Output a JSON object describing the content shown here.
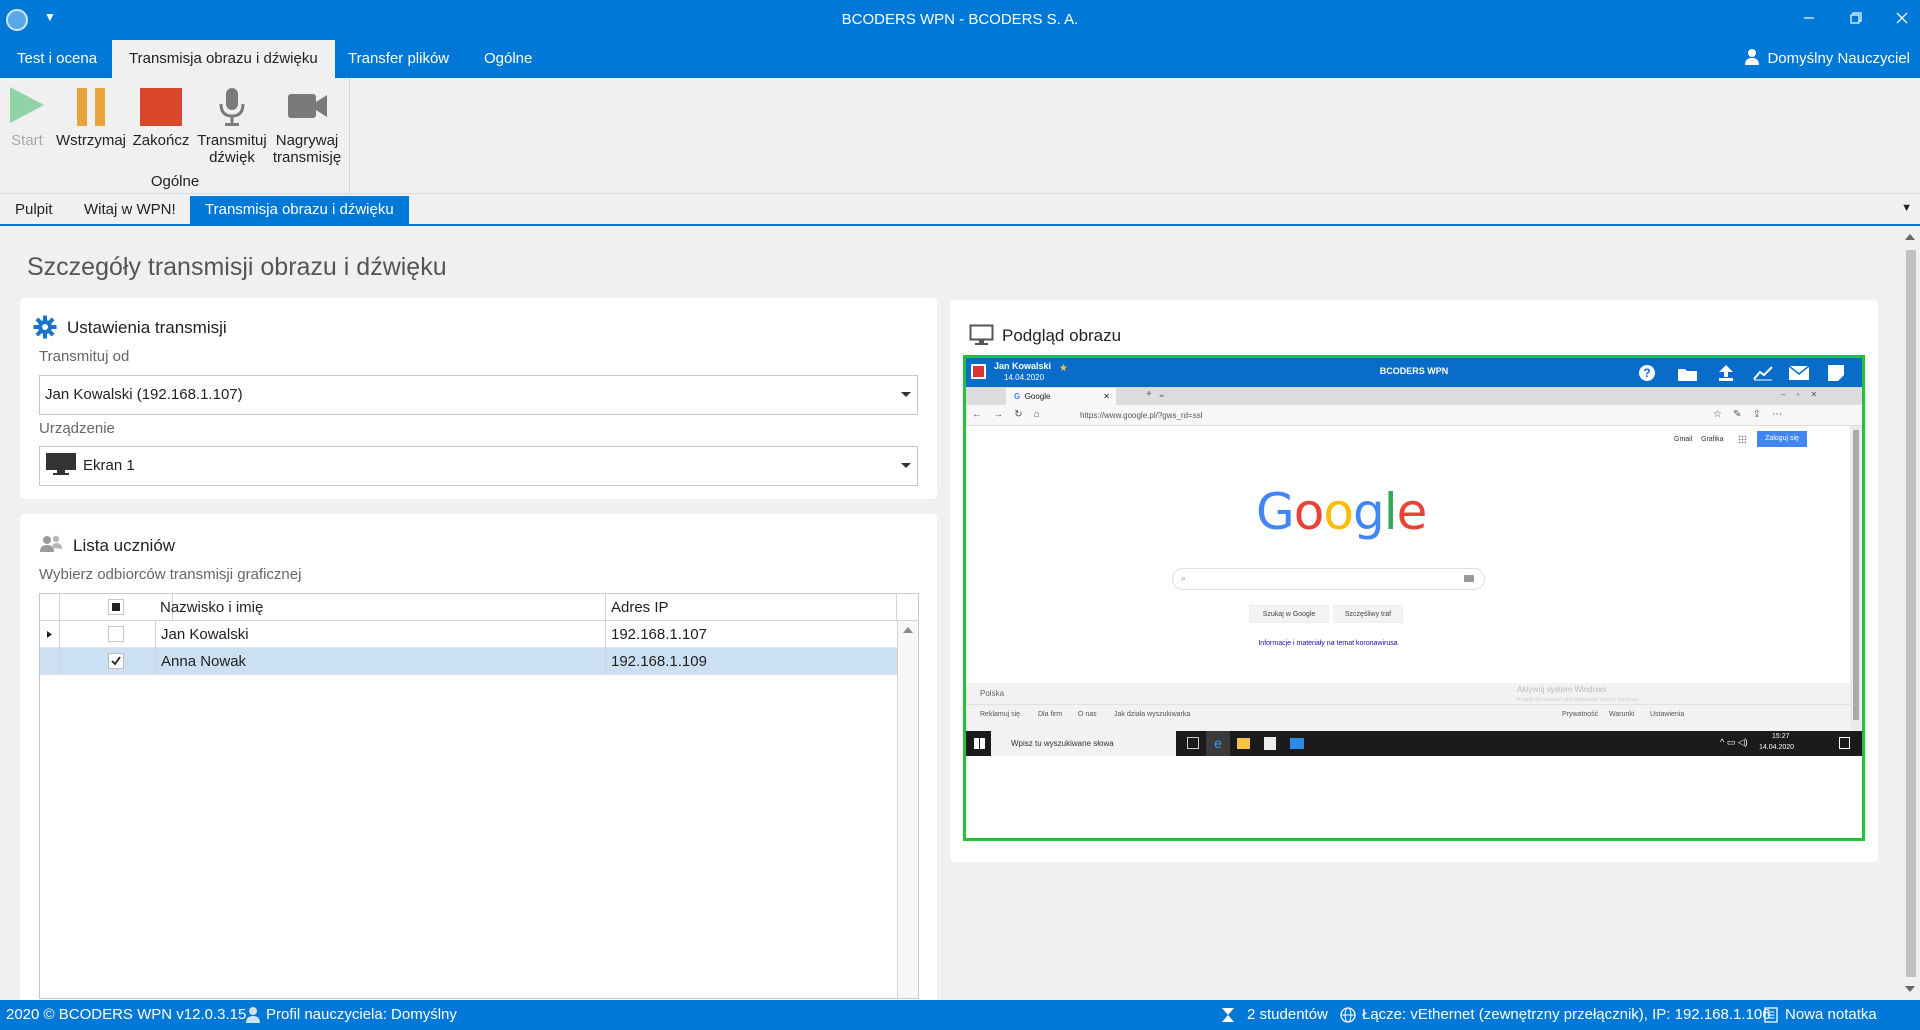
{
  "window": {
    "title": "BCODERS WPN - BCODERS S. A."
  },
  "menu": {
    "tabs": [
      {
        "label": "Test i ocena"
      },
      {
        "label": "Transmisja obrazu i dźwięku"
      },
      {
        "label": "Transfer plików"
      },
      {
        "label": "Ogólne"
      }
    ],
    "user": "Domyślny Nauczyciel"
  },
  "ribbon": {
    "buttons": [
      {
        "label": "Start",
        "icon": "play-icon",
        "enabled": false
      },
      {
        "label": "Wstrzymaj",
        "icon": "pause-icon",
        "enabled": true
      },
      {
        "label": "Zakończ",
        "icon": "stop-icon",
        "enabled": true
      },
      {
        "label_line1": "Transmituj",
        "label_line2": "dźwięk",
        "icon": "microphone-icon",
        "enabled": true
      },
      {
        "label_line1": "Nagrywaj",
        "label_line2": "transmisję",
        "icon": "video-camera-icon",
        "enabled": true
      }
    ],
    "group_label": "Ogólne"
  },
  "doc_tabs": [
    {
      "label": "Pulpit"
    },
    {
      "label": "Witaj w WPN!"
    },
    {
      "label": "Transmisja obrazu i dźwięku"
    }
  ],
  "page": {
    "title": "Szczegóły transmisji obrazu i dźwięku"
  },
  "settings": {
    "title": "Ustawienia transmisji",
    "source_label": "Transmituj od",
    "source_value": "Jan Kowalski (192.168.1.107)",
    "device_label": "Urządzenie",
    "device_value": "Ekran 1"
  },
  "students": {
    "title": "Lista uczniów",
    "subtitle": "Wybierz odbiorców transmisji graficznej",
    "columns": [
      "Nazwisko i imię",
      "Adres IP"
    ],
    "rows": [
      {
        "name": "Jan Kowalski",
        "ip": "192.168.1.107",
        "checked": false,
        "selected": false
      },
      {
        "name": "Anna Nowak",
        "ip": "192.168.1.109",
        "checked": true,
        "selected": true
      }
    ]
  },
  "preview": {
    "title": "Podgląd obrazu",
    "remote": {
      "app_user": "Jan Kowalski",
      "app_date": "14.04.2020",
      "app_title": "BCODERS WPN",
      "browser_tab": "Google",
      "url": "https://www.google.pl/?gws_rd=ssl",
      "header_links": [
        "Gmail",
        "Grafika"
      ],
      "signin_button": "Zaloguj się",
      "logo": "Google",
      "search_button": "Szukaj w Google",
      "lucky_button": "Szczęśliwy traf",
      "info_link": "Informacje i materiały na temat koronawirusa",
      "footer_country": "Polska",
      "footer_left": [
        "Reklamuj się",
        "Dla firm",
        "O nas",
        "Jak działa wyszukiwarka"
      ],
      "footer_right": [
        "Prywatność",
        "Warunki",
        "Ustawienia"
      ],
      "activate_title": "Aktywuj system Windows",
      "activate_sub": "Przejdź do ustawień, aby aktywować system Windows.",
      "taskbar_search": "Wpisz tu wyszukiwane słowa",
      "clock_time": "15:27",
      "clock_date": "14.04.2020"
    }
  },
  "status": {
    "copyright": "2020 ©  BCODERS WPN v12.0.3.15",
    "profile": "Profil nauczyciela: Domyślny",
    "students": "2 studentów",
    "connection": "Łącze: vEthernet (zewnętrzny przełącznik), IP: 192.168.1.106",
    "notes": "Nowa notatka"
  },
  "colors": {
    "accent": "#0078d7",
    "preview_border": "#22c33a",
    "selected_row": "#cce0f4",
    "pause": "#e8a33a",
    "stop": "#d9482b",
    "play_disabled": "#8fd3a6"
  }
}
